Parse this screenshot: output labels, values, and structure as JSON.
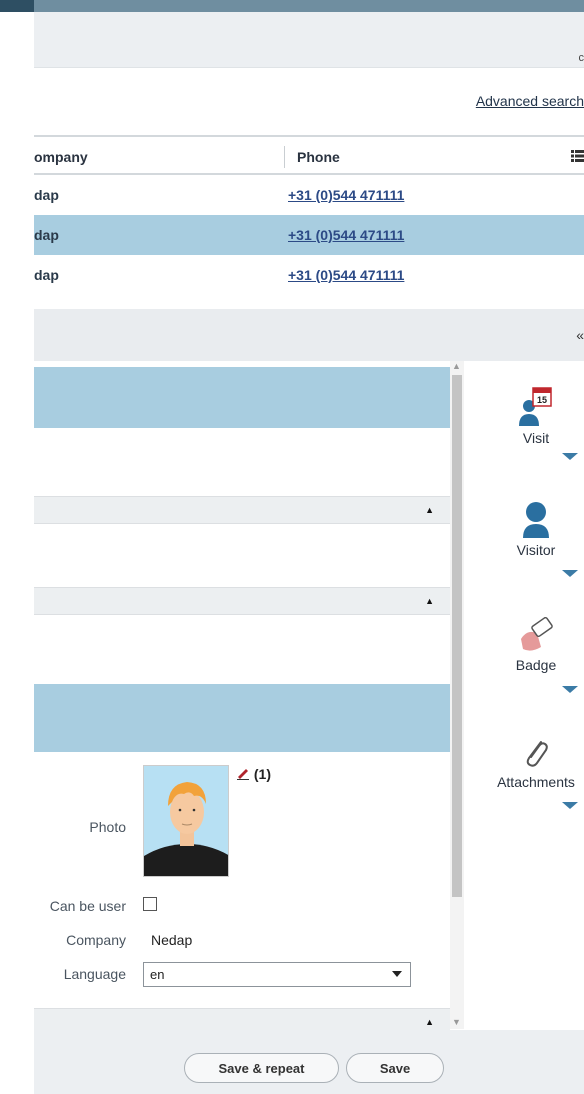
{
  "header": {
    "advanced_search": "Advanced search",
    "toolbar_glyph": "c"
  },
  "grid": {
    "columns": [
      "ompany",
      "Phone"
    ],
    "rows": [
      {
        "company": "dap",
        "phone": "+31 (0)544 471111",
        "selected": false
      },
      {
        "company": "dap",
        "phone": "+31 (0)544 471111",
        "selected": true
      },
      {
        "company": "dap",
        "phone": "+31 (0)544 471111",
        "selected": false
      }
    ]
  },
  "section": {
    "collapse_glyph": "«"
  },
  "form": {
    "photo_label": "Photo",
    "photo_count": "(1)",
    "can_be_user_label": "Can be user",
    "company_label": "Company",
    "company_value": "Nedap",
    "language_label": "Language",
    "language_value": "en"
  },
  "actions": {
    "save_repeat": "Save & repeat",
    "save": "Save"
  },
  "side_panel": {
    "items": [
      {
        "label": "Visit",
        "icon": "calendar-person-icon",
        "badge": "15"
      },
      {
        "label": "Visitor",
        "icon": "person-icon"
      },
      {
        "label": "Badge",
        "icon": "badge-card-icon"
      },
      {
        "label": "Attachments",
        "icon": "paperclip-icon"
      }
    ]
  },
  "colors": {
    "selection": "#a8cde0",
    "link": "#2c4a86",
    "accent_caret": "#3b7ba6",
    "topbar": "#6f8ea0"
  }
}
